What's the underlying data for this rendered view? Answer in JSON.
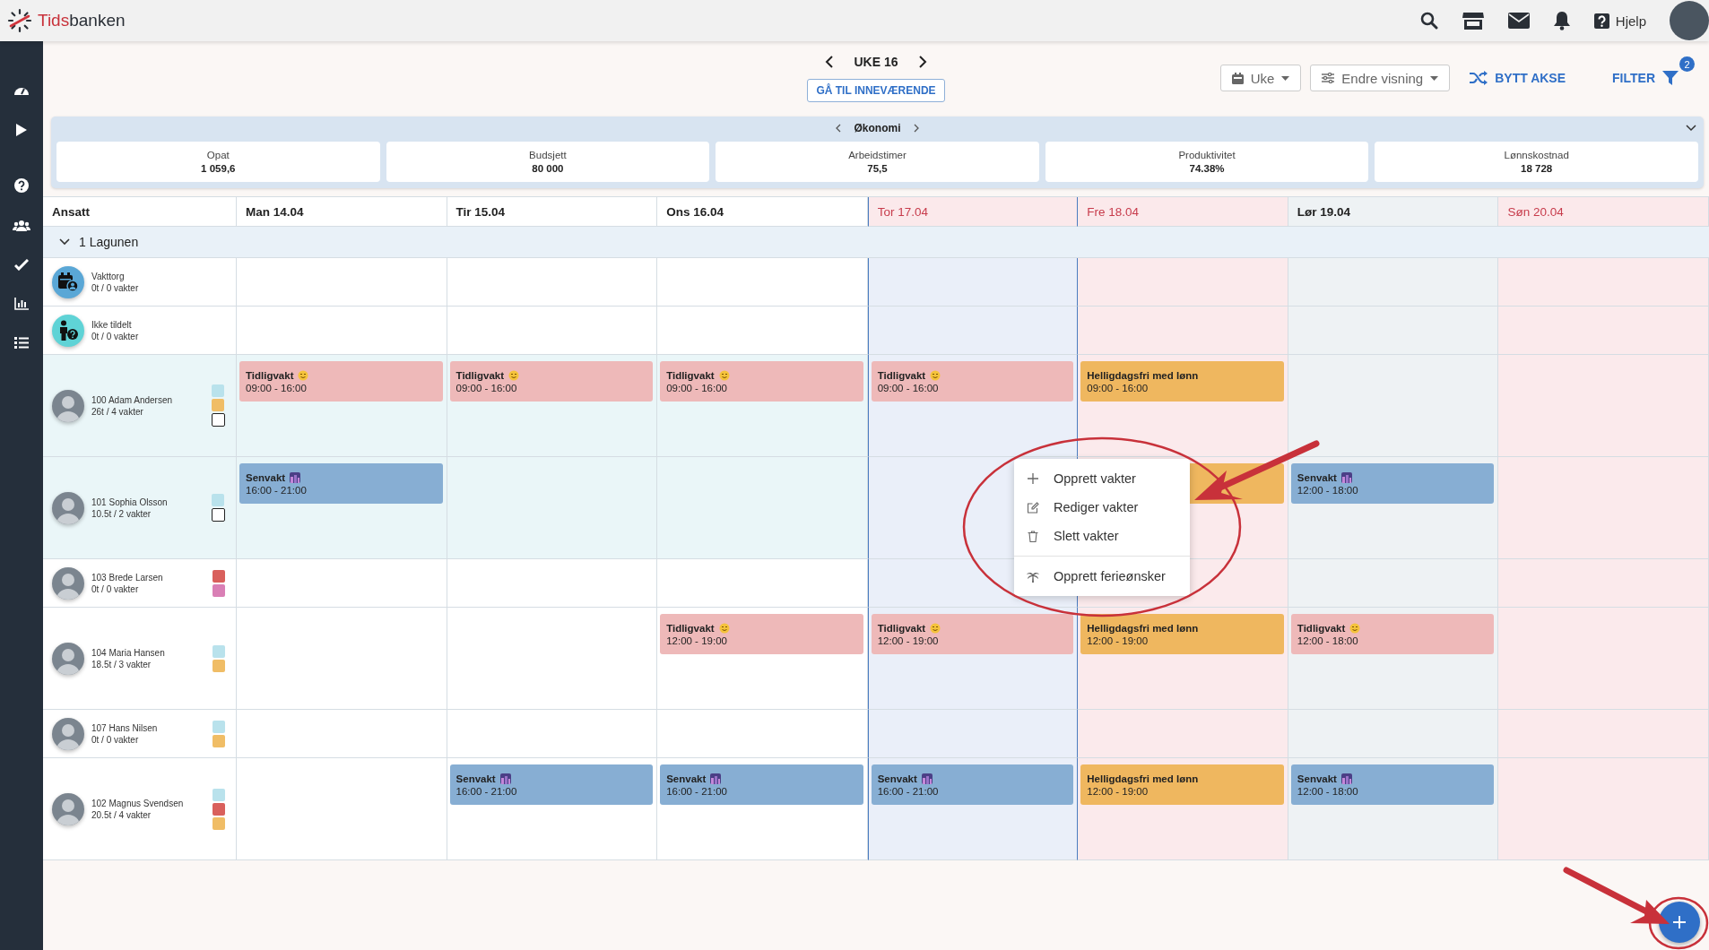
{
  "brand": {
    "accent": "Tids",
    "rest": "banken"
  },
  "topbar": {
    "help": "Hjelp"
  },
  "week": {
    "label": "UKE 16",
    "today_button": "GÅ TIL INNEVÆRENDE"
  },
  "toolbar": {
    "period": "Uke",
    "view": "Endre visning",
    "swap": "BYTT AKSE",
    "filter": "FILTER",
    "filter_count": "2"
  },
  "economy": {
    "title": "Økonomi",
    "cards": [
      {
        "label": "Opat",
        "value": "1 059,6"
      },
      {
        "label": "Budsjett",
        "value": "80 000"
      },
      {
        "label": "Arbeidstimer",
        "value": "75,5"
      },
      {
        "label": "Produktivitet",
        "value": "74.38%"
      },
      {
        "label": "Lønnskostnad",
        "value": "18 728"
      }
    ]
  },
  "grid": {
    "corner": "Ansatt",
    "days": [
      {
        "label": "Man 14.04",
        "kind": "weekday",
        "selected": false
      },
      {
        "label": "Tir 15.04",
        "kind": "weekday",
        "selected": false
      },
      {
        "label": "Ons 16.04",
        "kind": "weekday",
        "selected": false
      },
      {
        "label": "Tor 17.04",
        "kind": "holiday",
        "selected": true
      },
      {
        "label": "Fre 18.04",
        "kind": "holiday",
        "selected": false
      },
      {
        "label": "Lør 19.04",
        "kind": "weekend",
        "selected": false
      },
      {
        "label": "Søn 20.04",
        "kind": "holiday",
        "selected": false
      }
    ],
    "group": {
      "name": "1 Lagunen",
      "expanded": true
    },
    "employees": [
      {
        "name": "Vakttorg",
        "hours": "0t / 0 vakter",
        "kind": "market",
        "highlighted": false,
        "shifts": [
          {
            "kind": "empty"
          },
          {
            "kind": "empty"
          },
          {
            "kind": "empty"
          },
          {
            "kind": "empty"
          },
          {
            "kind": "empty"
          },
          {
            "kind": "empty"
          },
          {
            "kind": "empty"
          }
        ]
      },
      {
        "name": "Ikke tildelt",
        "hours": "0t / 0 vakter",
        "kind": "unassigned",
        "highlighted": false,
        "shifts": [
          {
            "kind": "empty"
          },
          {
            "kind": "empty"
          },
          {
            "kind": "empty"
          },
          {
            "kind": "empty"
          },
          {
            "kind": "empty"
          },
          {
            "kind": "empty"
          },
          {
            "kind": "empty"
          }
        ]
      },
      {
        "name": "100 Adam Andersen",
        "hours": "26t / 4 vakter",
        "kind": "person",
        "highlighted": true,
        "checked": false,
        "tags": [
          {
            "color": "#b9e2ec"
          },
          {
            "color": "#f0bd66"
          }
        ],
        "shifts": [
          {
            "kind": "early",
            "title": "Tidligvakt",
            "time": "09:00 - 16:00"
          },
          {
            "kind": "early",
            "title": "Tidligvakt",
            "time": "09:00 - 16:00"
          },
          {
            "kind": "early",
            "title": "Tidligvakt",
            "time": "09:00 - 16:00"
          },
          {
            "kind": "early",
            "title": "Tidligvakt",
            "time": "09:00 - 16:00"
          },
          {
            "kind": "holiday",
            "title": "Helligdagsfri med lønn",
            "time": "09:00 - 16:00"
          },
          {
            "kind": "empty"
          },
          {
            "kind": "empty"
          }
        ]
      },
      {
        "name": "101 Sophia Olsson",
        "hours": "10.5t / 2 vakter",
        "kind": "person",
        "highlighted": true,
        "checked": false,
        "tags": [
          {
            "color": "#b9e2ec"
          }
        ],
        "shifts": [
          {
            "kind": "late",
            "title": "Senvakt",
            "time": "16:00 - 21:00"
          },
          {
            "kind": "empty"
          },
          {
            "kind": "empty"
          },
          {
            "kind": "empty"
          },
          {
            "kind": "holiday"
          },
          {
            "kind": "late",
            "title": "Senvakt",
            "time": "12:00 - 18:00"
          },
          {
            "kind": "empty"
          }
        ]
      },
      {
        "name": "103 Brede Larsen",
        "hours": "0t / 0 vakter",
        "kind": "person",
        "highlighted": false,
        "tags": [
          {
            "color": "#d9605c"
          },
          {
            "color": "#d97fb5"
          }
        ],
        "shifts": [
          {
            "kind": "empty"
          },
          {
            "kind": "empty"
          },
          {
            "kind": "empty"
          },
          {
            "kind": "empty"
          },
          {
            "kind": "empty"
          },
          {
            "kind": "empty"
          },
          {
            "kind": "empty"
          }
        ]
      },
      {
        "name": "104 Maria Hansen",
        "hours": "18.5t / 3 vakter",
        "kind": "person",
        "highlighted": false,
        "tags": [
          {
            "color": "#b9e2ec"
          },
          {
            "color": "#f0bd66"
          }
        ],
        "shifts": [
          {
            "kind": "empty"
          },
          {
            "kind": "empty"
          },
          {
            "kind": "early",
            "title": "Tidligvakt",
            "time": "12:00 - 19:00"
          },
          {
            "kind": "early",
            "title": "Tidligvakt",
            "time": "12:00 - 19:00"
          },
          {
            "kind": "holiday",
            "title": "Helligdagsfri med lønn",
            "time": "12:00 - 19:00"
          },
          {
            "kind": "early",
            "title": "Tidligvakt",
            "time": "12:00 - 18:00"
          },
          {
            "kind": "empty"
          }
        ]
      },
      {
        "name": "107 Hans Nilsen",
        "hours": "0t / 0 vakter",
        "kind": "person",
        "highlighted": false,
        "tags": [
          {
            "color": "#b9e2ec"
          },
          {
            "color": "#f0bd66"
          }
        ],
        "shifts": [
          {
            "kind": "empty"
          },
          {
            "kind": "empty"
          },
          {
            "kind": "empty"
          },
          {
            "kind": "empty"
          },
          {
            "kind": "empty"
          },
          {
            "kind": "empty"
          },
          {
            "kind": "empty"
          }
        ]
      },
      {
        "name": "102 Magnus Svendsen",
        "hours": "20.5t / 4 vakter",
        "kind": "person",
        "highlighted": false,
        "tags": [
          {
            "color": "#b9e2ec"
          },
          {
            "color": "#d9605c"
          },
          {
            "color": "#f0bd66"
          }
        ],
        "shifts": [
          {
            "kind": "empty"
          },
          {
            "kind": "late",
            "title": "Senvakt",
            "time": "16:00 - 21:00"
          },
          {
            "kind": "late",
            "title": "Senvakt",
            "time": "16:00 - 21:00"
          },
          {
            "kind": "late",
            "title": "Senvakt",
            "time": "16:00 - 21:00"
          },
          {
            "kind": "holiday",
            "title": "Helligdagsfri med lønn",
            "time": "12:00 - 19:00"
          },
          {
            "kind": "late",
            "title": "Senvakt",
            "time": "12:00 - 18:00"
          },
          {
            "kind": "empty"
          }
        ]
      }
    ]
  },
  "context_menu": {
    "items": [
      {
        "kind": "add",
        "label": "Opprett vakter"
      },
      {
        "kind": "edit",
        "label": "Rediger vakter"
      },
      {
        "kind": "delete",
        "label": "Slett vakter"
      },
      {
        "kind": "vacation",
        "label": "Opprett ferieønsker"
      }
    ]
  }
}
